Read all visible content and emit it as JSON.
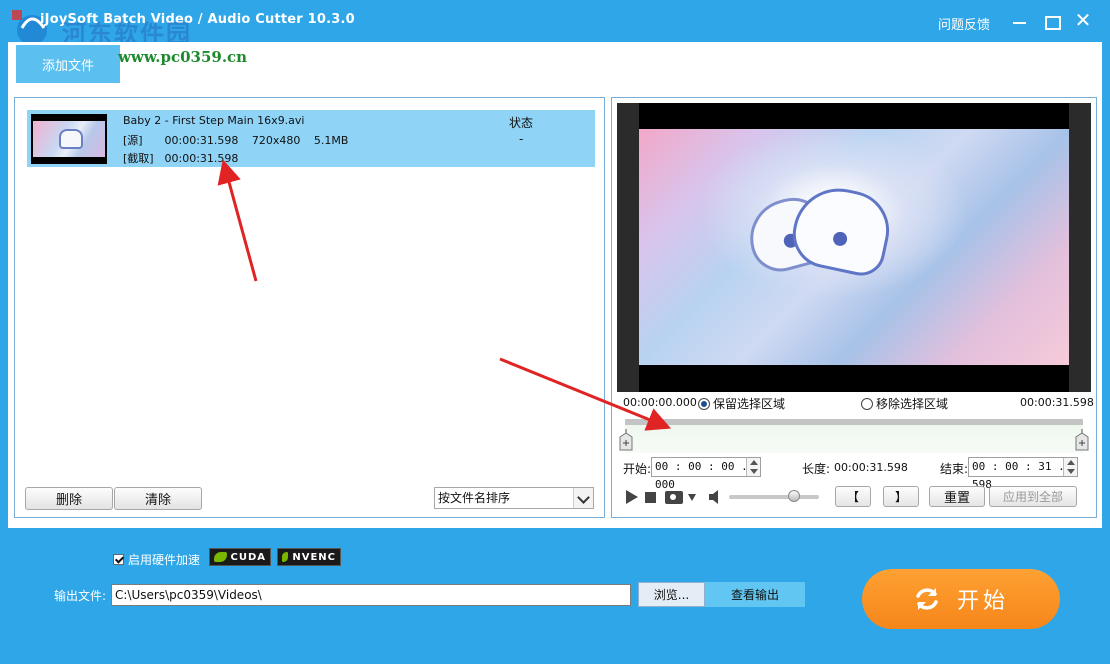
{
  "window": {
    "title": "iJoySoft Batch Video / Audio Cutter 10.3.0",
    "feedback_label": "问题反馈",
    "close_glyph": "✕"
  },
  "watermark": {
    "site_name": "河东软件园",
    "url": "www.pc0359.cn"
  },
  "toolbar": {
    "add_file_label": "添加文件"
  },
  "file_list": {
    "status_header": "状态",
    "items": [
      {
        "name": "Baby 2 - First Step Main 16x9.avi",
        "source_label": "[源]",
        "duration": "00:00:31.598",
        "resolution": "720x480",
        "size": "5.1MB",
        "clip_label": "[截取]",
        "clip_duration": "00:00:31.598",
        "status": "-"
      }
    ],
    "delete_label": "删除",
    "clear_label": "清除",
    "sort_label": "按文件名排序"
  },
  "preview": {
    "time_start": "00:00:00.000",
    "time_end": "00:00:31.598",
    "keep_label": "保留选择区域",
    "remove_label": "移除选择区域",
    "keep_selected": true,
    "start_label": "开始:",
    "start_value": "00 : 00 : 00 . 000",
    "length_label": "长度:",
    "length_value": "00:00:31.598",
    "end_label": "结束:",
    "end_value": "00 : 00 : 31 . 598",
    "mark_in_label": "【",
    "mark_out_label": "】",
    "reset_label": "重置",
    "apply_all_label": "应用到全部",
    "volume_level": 0.72
  },
  "bottom": {
    "hw_accel_label": "启用硬件加速",
    "hw_accel_checked": true,
    "cuda_label": "CUDA",
    "nvenc_label": "NVENC",
    "output_label": "输出文件:",
    "output_path": "C:\\Users\\pc0359\\Videos\\",
    "browse_label": "浏览...",
    "view_output_label": "查看输出",
    "start_label": "开始"
  },
  "colors": {
    "background": "#2ea6e8",
    "accent_orange": "#f5861a",
    "selected_row": "#8fd4f7",
    "add_button": "#5bc0ef",
    "annotation_arrow": "#e02424"
  }
}
